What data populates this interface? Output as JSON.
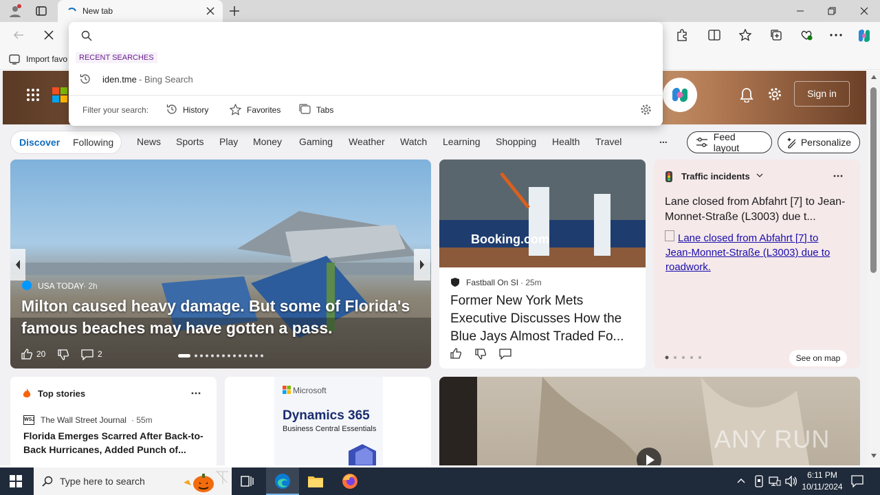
{
  "browser": {
    "tab_title": "New tab",
    "favorites_bar_label": "Import favo"
  },
  "search_dropdown": {
    "section_header": "RECENT SEARCHES",
    "recent": [
      {
        "query": "iden.tme",
        "source": " - Bing Search"
      }
    ],
    "filter_label": "Filter your search:",
    "filters": [
      "History",
      "Favorites",
      "Tabs"
    ]
  },
  "header": {
    "sign_in": "Sign in"
  },
  "nav": {
    "tabs": [
      "Discover",
      "Following"
    ],
    "links": [
      "News",
      "Sports",
      "Play",
      "Money",
      "Gaming",
      "Weather",
      "Watch",
      "Learning",
      "Shopping",
      "Health",
      "Travel"
    ],
    "more": "...",
    "feed_layout": "Feed layout",
    "personalize": "Personalize"
  },
  "hero": {
    "source": "USA TODAY",
    "age": " · 2h",
    "headline": "Milton caused heavy damage. But some of Florida's famous beaches may have gotten a pass.",
    "likes": "20",
    "comments": "2"
  },
  "mets_card": {
    "banner_text": "Booking.com",
    "source": "Fastball On SI",
    "age": " · 25m",
    "headline": "Former New York Mets Executive Discusses How the Blue Jays Almost Traded Fo..."
  },
  "traffic": {
    "title": "Traffic incidents",
    "headline": "Lane closed from Abfahrt [7] to Jean-Monnet-Straße (L3003) due t...",
    "link": "Lane closed from Abfahrt [7] to Jean-Monnet-Straße (L3003) due to roadwork.",
    "see_on_map": "See on map"
  },
  "top_stories": {
    "title": "Top stories",
    "source": "The Wall Street Journal",
    "age": " · 55m",
    "headline": "Florida Emerges Scarred After Back-to-Back Hurricanes, Added Punch of...",
    "source_logo": "WSJ"
  },
  "ad": {
    "brand": "Microsoft",
    "product": "Dynamics 365",
    "subtitle": "Business Central Essentials"
  },
  "video": {
    "watermark": "ANY RUN"
  },
  "taskbar": {
    "search_placeholder": "Type here to search",
    "time": "6:11 PM",
    "date": "10/11/2024"
  },
  "colors": {
    "accent": "#0f6cbd",
    "taskbar": "#1f2a3a",
    "link": "#1a0dab"
  }
}
